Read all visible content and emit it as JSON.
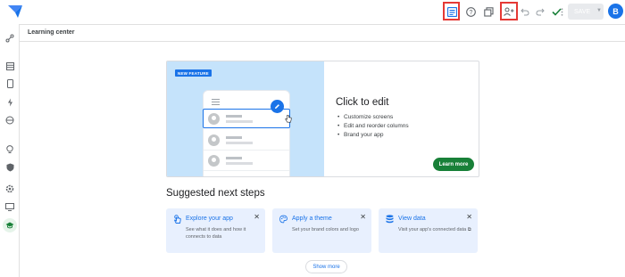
{
  "header": {
    "title": "Learning center"
  },
  "toolbar": {
    "save_label": "SAVE",
    "avatar_initial": "B",
    "icons": [
      "preview-icon",
      "help-icon",
      "copy-icon",
      "share-icon",
      "undo-icon",
      "redo-icon",
      "check-icon"
    ]
  },
  "rail": {
    "items": [
      "data-icon",
      "table-icon",
      "mobile-icon",
      "automation-icon",
      "security-icon",
      "lightbulb-icon",
      "shield-icon",
      "settings-icon",
      "monitor-icon",
      "learning-icon"
    ]
  },
  "hero": {
    "badge": "NEW FEATURE",
    "title": "Click to edit",
    "bullets": [
      "Customize screens",
      "Edit and reorder columns",
      "Brand your app"
    ],
    "button": "Learn more"
  },
  "suggested": {
    "title": "Suggested next steps",
    "cards": [
      {
        "title": "Explore your app",
        "desc": "See what it does and how it connects to data",
        "icon": "touch-icon"
      },
      {
        "title": "Apply a theme",
        "desc": "Set your brand colors and logo",
        "icon": "palette-icon"
      },
      {
        "title": "View data",
        "desc": "Visit your app's connected data ⧉",
        "icon": "database-icon"
      }
    ],
    "show_more": "Show more"
  },
  "colors": {
    "accent": "#1a73e8",
    "success": "#188038",
    "highlight": "#e53935",
    "hero_bg": "#c5e3fb"
  }
}
